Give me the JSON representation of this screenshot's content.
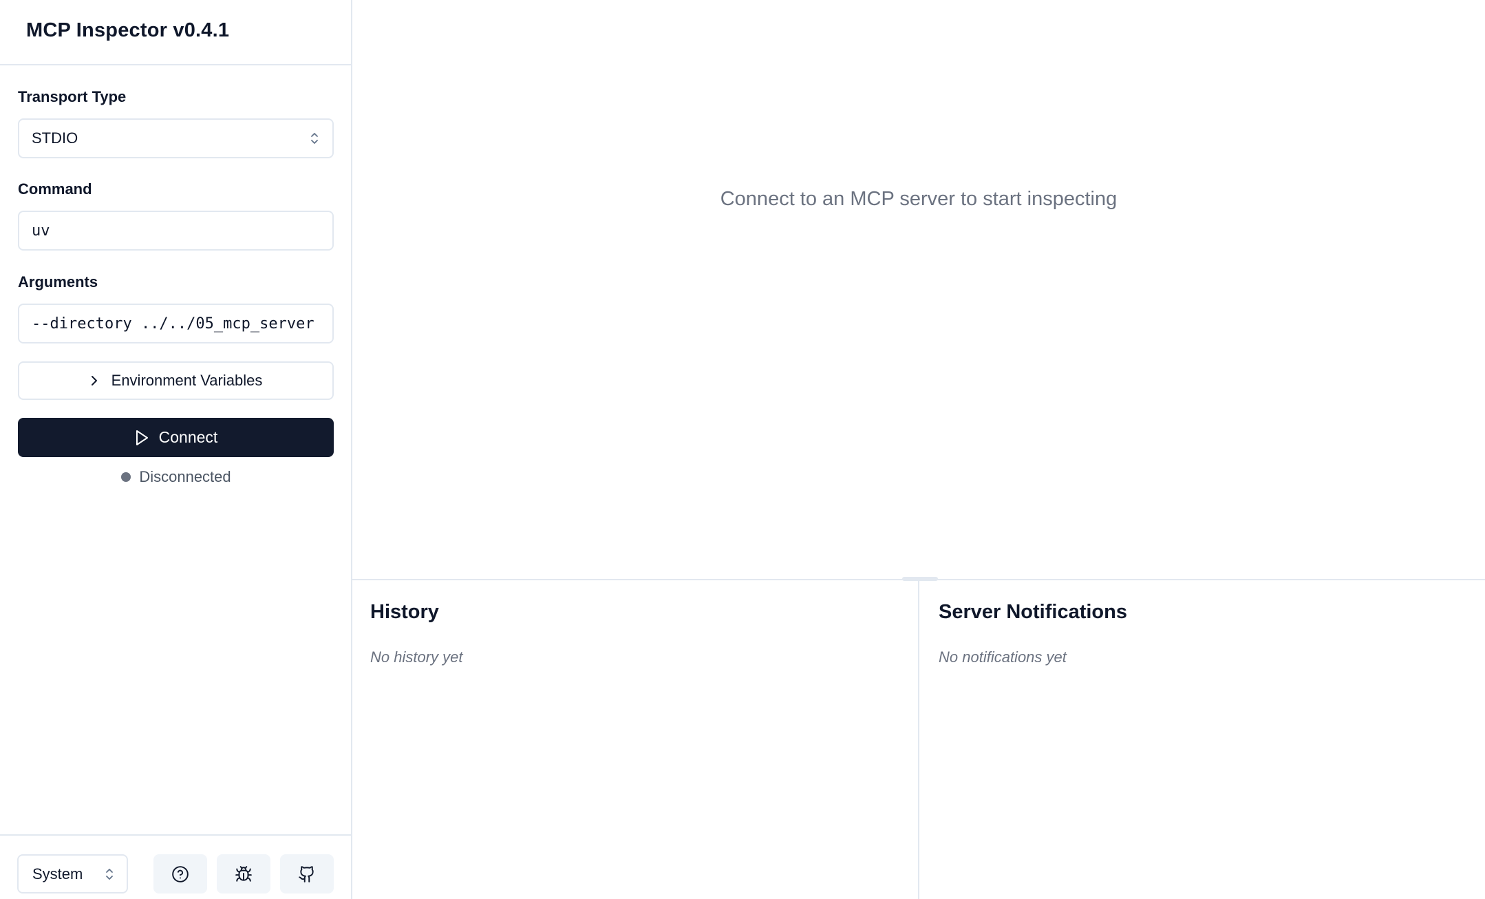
{
  "app": {
    "title": "MCP Inspector v0.4.1"
  },
  "sidebar": {
    "transport": {
      "label": "Transport Type",
      "selected": "STDIO",
      "icon": "chevron-up-down-icon"
    },
    "command": {
      "label": "Command",
      "value": "uv"
    },
    "arguments": {
      "label": "Arguments",
      "value": "--directory ../../05_mcp_server"
    },
    "env_button": {
      "label": "Environment Variables",
      "icon": "chevron-right-icon"
    },
    "connect_button": {
      "label": "Connect",
      "icon": "play-icon",
      "bg": "#121a2d"
    },
    "status": {
      "text": "Disconnected",
      "dot_color": "#6b7280"
    },
    "footer": {
      "theme_selected": "System",
      "buttons": [
        "help-icon",
        "bug-icon",
        "github-icon"
      ]
    }
  },
  "main": {
    "placeholder": "Connect to an MCP server to start inspecting",
    "history": {
      "title": "History",
      "empty": "No history yet"
    },
    "notifications": {
      "title": "Server Notifications",
      "empty": "No notifications yet"
    }
  }
}
